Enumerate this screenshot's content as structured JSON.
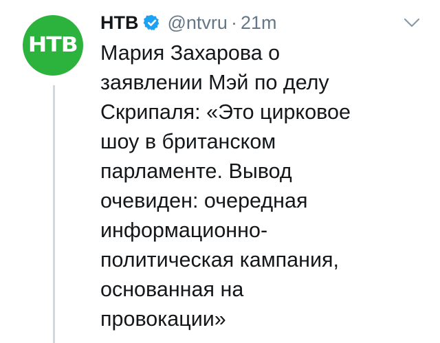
{
  "tweet": {
    "author": {
      "name": "НТВ",
      "handle": "@ntvru",
      "verified": true,
      "avatar_text": "НТВ",
      "avatar_color": "#2bb33d"
    },
    "separator": "·",
    "time": "21m",
    "text": "Мария Захарова о\nзаявлении Мэй по делу\nСкрипаля:  «Это цирковое\nшоу в британском\nпарламенте. Вывод\nочевиден: очередная\nинформационно-\nполитическая кампания,\nоснованная на\nпровокации»"
  },
  "icons": {
    "verified": "verified-badge-icon",
    "more": "chevron-down-icon"
  },
  "colors": {
    "verified_blue": "#1da1f2",
    "muted_gray": "#657786",
    "thread_line": "#cfd8dd"
  }
}
